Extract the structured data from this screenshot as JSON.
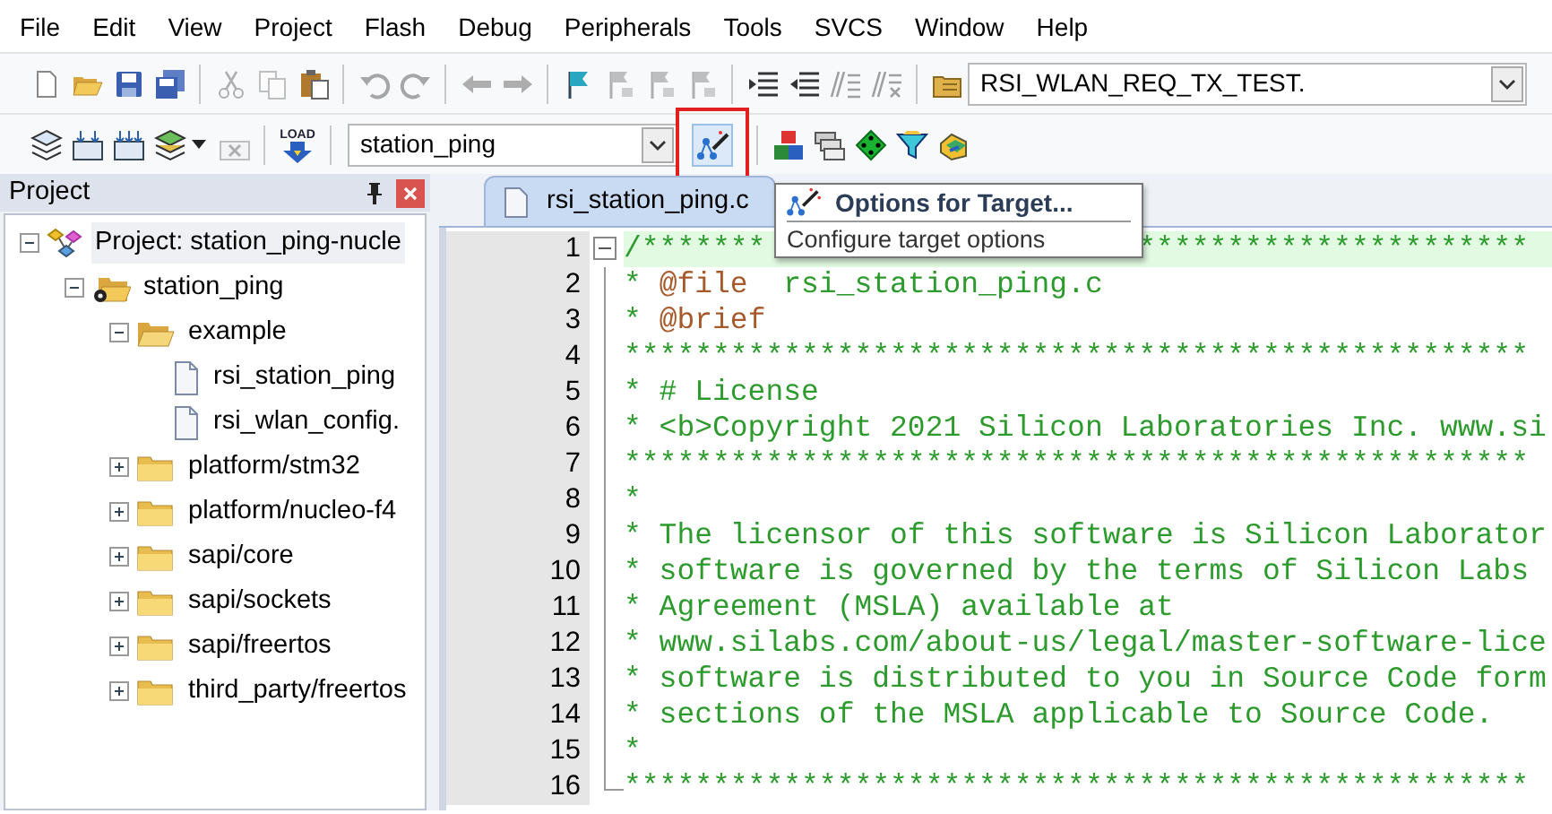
{
  "menu": [
    "File",
    "Edit",
    "View",
    "Project",
    "Flash",
    "Debug",
    "Peripherals",
    "Tools",
    "SVCS",
    "Window",
    "Help"
  ],
  "toolbar_1": [
    {
      "kind": "button",
      "disabled": false
    },
    {
      "kind": "button",
      "disabled": false
    },
    {
      "kind": "button",
      "disabled": false
    },
    {
      "kind": "button",
      "disabled": false
    },
    {
      "kind": "separator"
    },
    {
      "kind": "button",
      "disabled": true
    },
    {
      "kind": "button",
      "disabled": true
    },
    {
      "kind": "button",
      "disabled": false
    },
    {
      "kind": "separator"
    },
    {
      "kind": "button",
      "disabled": true
    },
    {
      "kind": "button",
      "disabled": true
    },
    {
      "kind": "separator"
    },
    {
      "kind": "button",
      "disabled": true
    },
    {
      "kind": "button",
      "disabled": true
    },
    {
      "kind": "separator"
    },
    {
      "kind": "button",
      "disabled": false
    },
    {
      "kind": "button",
      "disabled": true
    },
    {
      "kind": "button",
      "disabled": true
    },
    {
      "kind": "button",
      "disabled": true
    },
    {
      "kind": "separator"
    },
    {
      "kind": "button",
      "disabled": false
    },
    {
      "kind": "button",
      "disabled": false
    },
    {
      "kind": "button",
      "disabled": true
    },
    {
      "kind": "button",
      "disabled": true
    },
    {
      "kind": "separator"
    },
    {
      "kind": "button",
      "disabled": false
    },
    {
      "kind": "combo",
      "value": "RSI_WLAN_REQ_TX_TEST."
    }
  ],
  "toolbar_2": [
    {
      "kind": "button",
      "disabled": false
    },
    {
      "kind": "button",
      "disabled": false
    },
    {
      "kind": "button",
      "disabled": false
    },
    {
      "kind": "split",
      "disabled": false
    },
    {
      "kind": "button",
      "disabled": true
    },
    {
      "kind": "separator"
    },
    {
      "kind": "load",
      "label": "LOAD",
      "disabled": false
    },
    {
      "kind": "separator"
    },
    {
      "kind": "combo",
      "value": "station_ping"
    },
    {
      "kind": "button",
      "disabled": false,
      "hovered": true
    },
    {
      "kind": "separator"
    },
    {
      "kind": "button",
      "disabled": false
    },
    {
      "kind": "button",
      "disabled": false
    },
    {
      "kind": "button",
      "disabled": false
    },
    {
      "kind": "button",
      "disabled": false
    },
    {
      "kind": "button",
      "disabled": false
    }
  ],
  "project_panel": {
    "title": "Project",
    "tree": [
      {
        "kind": "project",
        "label": "Project: station_ping-nucle",
        "selected": true,
        "expanded": true,
        "children": [
          {
            "kind": "target",
            "label": "station_ping",
            "selected": false,
            "expanded": true,
            "children": [
              {
                "kind": "group",
                "label": "example",
                "selected": false,
                "expanded": true,
                "children": [
                  {
                    "kind": "file",
                    "label": "rsi_station_ping",
                    "selected": false
                  },
                  {
                    "kind": "file",
                    "label": "rsi_wlan_config.",
                    "selected": false
                  }
                ]
              },
              {
                "kind": "group",
                "label": "platform/stm32",
                "selected": false,
                "expanded": false
              },
              {
                "kind": "group",
                "label": "platform/nucleo-f4",
                "selected": false,
                "expanded": false
              },
              {
                "kind": "group",
                "label": "sapi/core",
                "selected": false,
                "expanded": false
              },
              {
                "kind": "group",
                "label": "sapi/sockets",
                "selected": false,
                "expanded": false
              },
              {
                "kind": "group",
                "label": "sapi/freertos",
                "selected": false,
                "expanded": false
              },
              {
                "kind": "group",
                "label": "third_party/freertos",
                "selected": false,
                "expanded": false
              }
            ]
          }
        ]
      }
    ]
  },
  "editor": {
    "tabs": [
      {
        "label": "rsi_station_ping.c",
        "selected": true
      }
    ],
    "lines": [
      {
        "num": "1",
        "current": true,
        "fold_start": true,
        "segments": [
          {
            "kind": "comment",
            "text": "/*******"
          }
        ],
        "tail": "**********************"
      },
      {
        "num": "2",
        "current": false,
        "segments": [
          {
            "kind": "comment",
            "text": "* "
          },
          {
            "kind": "tag",
            "text": "@file"
          },
          {
            "kind": "comment",
            "text": "  rsi_station_ping.c"
          }
        ]
      },
      {
        "num": "3",
        "current": false,
        "segments": [
          {
            "kind": "comment",
            "text": "* "
          },
          {
            "kind": "tag",
            "text": "@brief"
          }
        ]
      },
      {
        "num": "4",
        "current": false,
        "segments": [
          {
            "kind": "comment",
            "text": "***************************************************"
          }
        ]
      },
      {
        "num": "5",
        "current": false,
        "segments": [
          {
            "kind": "comment",
            "text": "* # License"
          }
        ]
      },
      {
        "num": "6",
        "current": false,
        "segments": [
          {
            "kind": "comment",
            "text": "* <b>Copyright 2021 Silicon Laboratories Inc. www.si"
          }
        ]
      },
      {
        "num": "7",
        "current": false,
        "segments": [
          {
            "kind": "comment",
            "text": "***************************************************"
          }
        ]
      },
      {
        "num": "8",
        "current": false,
        "segments": [
          {
            "kind": "comment",
            "text": "*"
          }
        ]
      },
      {
        "num": "9",
        "current": false,
        "segments": [
          {
            "kind": "comment",
            "text": "* The licensor of this software is Silicon Laborator"
          }
        ]
      },
      {
        "num": "10",
        "current": false,
        "segments": [
          {
            "kind": "comment",
            "text": "* software is governed by the terms of Silicon Labs"
          }
        ]
      },
      {
        "num": "11",
        "current": false,
        "segments": [
          {
            "kind": "comment",
            "text": "* Agreement (MSLA) available at"
          }
        ]
      },
      {
        "num": "12",
        "current": false,
        "segments": [
          {
            "kind": "comment",
            "text": "* www.silabs.com/about-us/legal/master-software-lice"
          }
        ]
      },
      {
        "num": "13",
        "current": false,
        "segments": [
          {
            "kind": "comment",
            "text": "* software is distributed to you in Source Code form"
          }
        ]
      },
      {
        "num": "14",
        "current": false,
        "segments": [
          {
            "kind": "comment",
            "text": "* sections of the MSLA applicable to Source Code."
          }
        ]
      },
      {
        "num": "15",
        "current": false,
        "segments": [
          {
            "kind": "comment",
            "text": "*"
          }
        ]
      },
      {
        "num": "16",
        "current": false,
        "fold_end": true,
        "segments": [
          {
            "kind": "comment",
            "text": "***************************************************"
          }
        ]
      }
    ]
  },
  "tooltip": {
    "title": "Options for Target...",
    "description": "Configure target options"
  }
}
